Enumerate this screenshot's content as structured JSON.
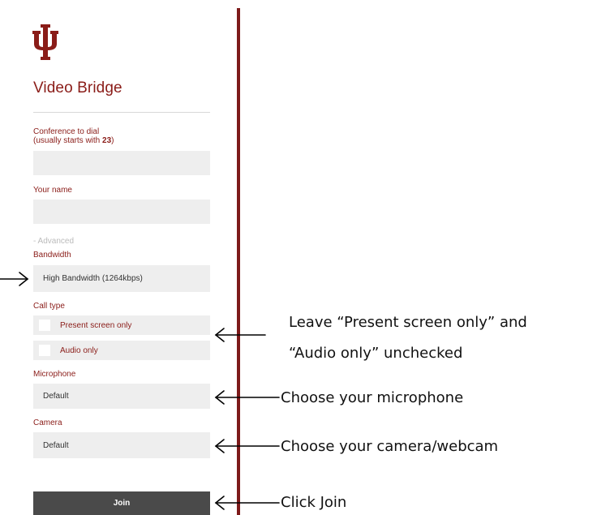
{
  "app": {
    "title": "Video Bridge"
  },
  "form": {
    "conference_label": "Conference to dial",
    "conference_hint_prefix": "(usually starts with ",
    "conference_hint_bold": "23",
    "conference_hint_suffix": ")",
    "conference_value": "",
    "name_label": "Your name",
    "name_value": "",
    "advanced_toggle": "- Advanced",
    "bandwidth_label": "Bandwidth",
    "bandwidth_value": "High Bandwidth (1264kbps)",
    "call_type_label": "Call type",
    "present_screen_only": "Present screen only",
    "audio_only": "Audio only",
    "present_screen_only_checked": false,
    "audio_only_checked": false,
    "microphone_label": "Microphone",
    "microphone_value": "Default",
    "camera_label": "Camera",
    "camera_value": "Default",
    "join_label": "Join"
  },
  "annotations": {
    "call_type_line1": "Leave “Present screen only” and",
    "call_type_line2": "“Audio only” unchecked",
    "microphone": "Choose your microphone",
    "camera": "Choose your camera/webcam",
    "join": "Click Join"
  },
  "colors": {
    "brand": "#8a1c18",
    "divider": "#7d1a1a",
    "field_bg": "#eeeeee",
    "join_bg": "#4a4a4a"
  }
}
